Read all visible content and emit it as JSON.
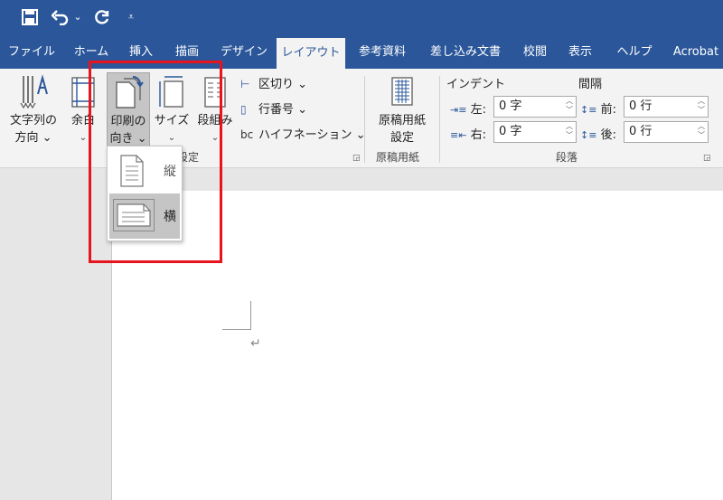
{
  "qat": {
    "save_icon": "save-icon",
    "undo_icon": "undo-icon",
    "undo_more": "⌄",
    "redo_icon": "redo-icon",
    "customize_icon": "customize-icon"
  },
  "tabs": [
    {
      "label": "ファイル"
    },
    {
      "label": "ホーム"
    },
    {
      "label": "挿入"
    },
    {
      "label": "描画"
    },
    {
      "label": "デザイン"
    },
    {
      "label": "レイアウト",
      "active": true
    },
    {
      "label": "参考資料"
    },
    {
      "label": "差し込み文書"
    },
    {
      "label": "校閲"
    },
    {
      "label": "表示"
    },
    {
      "label": "ヘルプ"
    },
    {
      "label": "Acrobat"
    }
  ],
  "page_setup": {
    "text_direction": [
      "文字列の",
      "方向 ⌄"
    ],
    "margins": [
      "余白",
      "⌄"
    ],
    "orientation": [
      "印刷の",
      "向き ⌄"
    ],
    "size": [
      "サイズ",
      "⌄"
    ],
    "columns": [
      "段組み",
      "⌄"
    ],
    "breaks": "区切り ⌄",
    "line_numbers": "行番号 ⌄",
    "hyphenation": "ハイフネーション ⌄",
    "hyphen_icon_text": "bc",
    "group_label": "設定"
  },
  "genko": {
    "button": [
      "原稿用紙",
      "設定"
    ],
    "group_label": "原稿用紙"
  },
  "paragraph": {
    "indent_title": "インデント",
    "spacing_title": "間隔",
    "left_label": "左:",
    "right_label": "右:",
    "before_label": "前:",
    "after_label": "後:",
    "left_value": "0 字",
    "right_value": "0 字",
    "before_value": "0 行",
    "after_value": "0 行",
    "group_label": "段落"
  },
  "orientation_menu": [
    {
      "label": "縦",
      "selected": false
    },
    {
      "label": "横",
      "selected": true
    }
  ],
  "document": {
    "paragraph_mark": "↵"
  },
  "colors": {
    "brand": "#2b579a",
    "highlight": "#e8141c"
  }
}
